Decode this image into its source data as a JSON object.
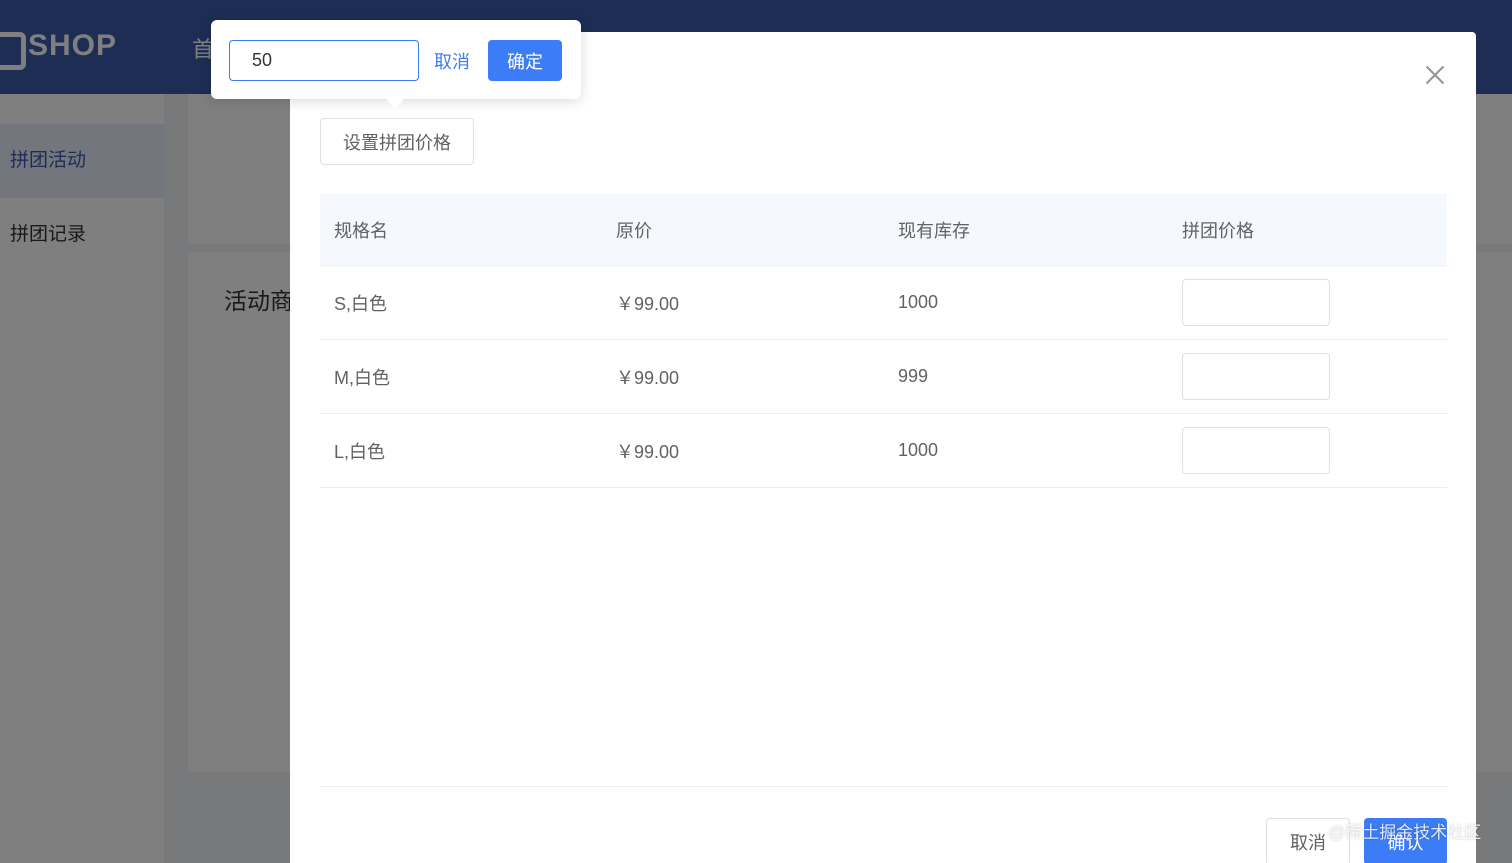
{
  "header": {
    "logo_text": "SHOP",
    "nav_partial": "首"
  },
  "sidebar": {
    "items": [
      {
        "label": "拼团活动"
      },
      {
        "label": "拼团记录"
      }
    ]
  },
  "content": {
    "title_partial": "活动商"
  },
  "dialog": {
    "set_price_label": "设置拼团价格",
    "columns": [
      "规格名",
      "原价",
      "现有库存",
      "拼团价格"
    ],
    "rows": [
      {
        "spec": "S,白色",
        "price": "￥99.00",
        "stock": "1000",
        "group_price": ""
      },
      {
        "spec": "M,白色",
        "price": "￥99.00",
        "stock": "999",
        "group_price": ""
      },
      {
        "spec": "L,白色",
        "price": "￥99.00",
        "stock": "1000",
        "group_price": ""
      }
    ],
    "cancel_label": "取消",
    "confirm_label": "确认"
  },
  "popover": {
    "input_value": "50",
    "cancel_label": "取消",
    "confirm_label": "确定"
  },
  "watermark": "@稀土掘金技术社区"
}
